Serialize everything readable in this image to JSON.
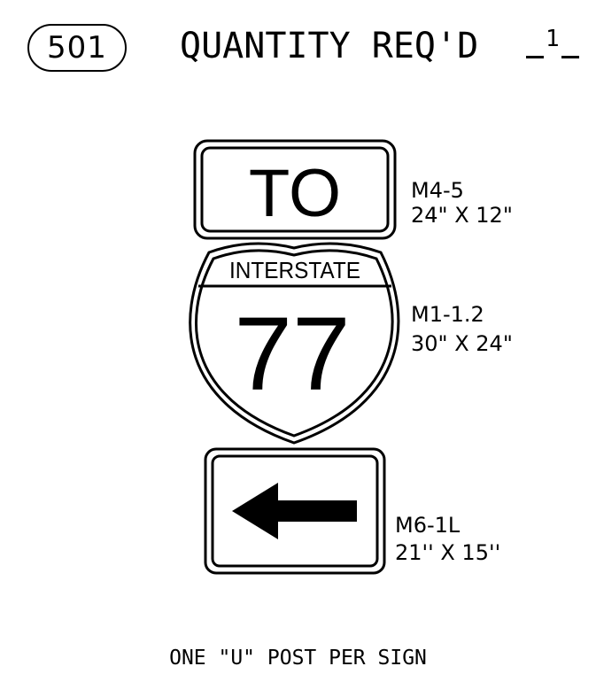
{
  "header": {
    "sheet_number": "501",
    "quantity_label": "QUANTITY REQ'D",
    "quantity_value": "1"
  },
  "signs": [
    {
      "code": "M4-5",
      "size": "24\" X 12\"",
      "legend": "TO"
    },
    {
      "code": "M1-1.2",
      "size": "30\" X 24\"",
      "banner": "INTERSTATE",
      "route_number": "77"
    },
    {
      "code": "M6-1L",
      "size": "21'' X 15''",
      "arrow_direction": "left"
    }
  ],
  "footer": {
    "note": "ONE \"U\" POST PER SIGN"
  },
  "colors": {
    "ink": "#000000",
    "background": "#ffffff"
  }
}
